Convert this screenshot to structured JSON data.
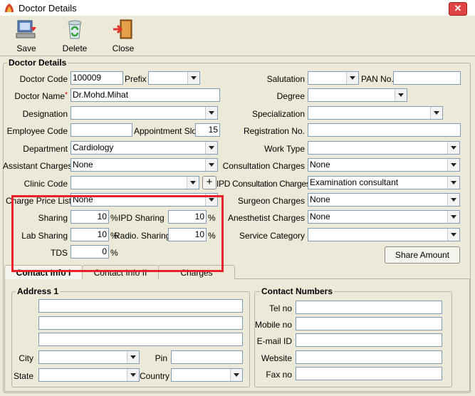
{
  "window": {
    "title": "Doctor Details",
    "close_glyph": "✕"
  },
  "toolbar": {
    "save": "Save",
    "delete": "Delete",
    "close": "Close"
  },
  "section_title": "Doctor Details",
  "fields": {
    "doctor_code": {
      "label": "Doctor Code",
      "value": "100009"
    },
    "prefix": {
      "label": "Prefix",
      "value": ""
    },
    "doctor_name": {
      "label": "Doctor Name",
      "value": "Dr.Mohd.Mihat",
      "required_mark": "*"
    },
    "designation": {
      "label": "Designation",
      "value": ""
    },
    "employee_code": {
      "label": "Employee Code",
      "value": ""
    },
    "appointment_slot": {
      "label": "Appointment Slot",
      "value": "15"
    },
    "department": {
      "label": "Department",
      "value": "Cardiology"
    },
    "assistant_charges": {
      "label": "Assistant Charges",
      "value": "None"
    },
    "clinic_code": {
      "label": "Clinic Code",
      "value": "",
      "add_glyph": "+"
    },
    "charge_price_list": {
      "label": "Charge Price List",
      "value": "None"
    },
    "sharing": {
      "label": "Sharing",
      "value": "10"
    },
    "ipd_sharing": {
      "label": "IPD Sharing",
      "value": "10"
    },
    "lab_sharing": {
      "label": "Lab Sharing",
      "value": "10"
    },
    "radio_sharing": {
      "label": "Radio. Sharing",
      "value": "10"
    },
    "tds": {
      "label": "TDS",
      "value": "0"
    },
    "salutation": {
      "label": "Salutation",
      "value": ""
    },
    "pan_no": {
      "label": "PAN No.",
      "value": ""
    },
    "degree": {
      "label": "Degree",
      "value": ""
    },
    "specialization": {
      "label": "Specialization",
      "value": ""
    },
    "registration_no": {
      "label": "Registration No.",
      "value": ""
    },
    "work_type": {
      "label": "Work Type",
      "value": ""
    },
    "consultation_charges": {
      "label": "Consultation Charges",
      "value": "None"
    },
    "ipd_consultation_charges": {
      "label": "IPD Consultation Charges",
      "value": "Examination consultant"
    },
    "surgeon_charges": {
      "label": "Surgeon Charges",
      "value": "None"
    },
    "anesthetist_charges": {
      "label": "Anesthetist Charges",
      "value": "None"
    },
    "service_category": {
      "label": "Service Category",
      "value": ""
    }
  },
  "percent_sign": "%",
  "share_amount_button": "Share Amount",
  "tabs": [
    "Contact Info I",
    "Contact Info II",
    "Charges"
  ],
  "address": {
    "title": "Address 1",
    "city_label": "City",
    "pin_label": "Pin",
    "state_label": "State",
    "country_label": "Country"
  },
  "contact": {
    "title": "Contact Numbers",
    "tel": "Tel no",
    "mobile": "Mobile no",
    "email": "E-mail ID",
    "website": "Website",
    "fax": "Fax no"
  },
  "colors": {
    "highlight": "#e8202a",
    "window_bg": "#ece9d8",
    "close_button": "#e04343"
  }
}
